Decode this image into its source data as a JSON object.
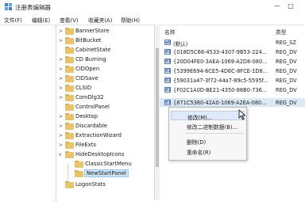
{
  "window": {
    "title": "注册表编辑器",
    "minimize_glyph": "—",
    "maximize_glyph": "□"
  },
  "menubar": [
    "文件(F)",
    "编辑(E)",
    "查看(V)",
    "收藏夹(A)",
    "帮助(H)"
  ],
  "tree": [
    {
      "label": "BannerStore",
      "expander": ">"
    },
    {
      "label": "BitBucket",
      "expander": ">"
    },
    {
      "label": "CabinetState",
      "expander": ""
    },
    {
      "label": "CD Burning",
      "expander": ">"
    },
    {
      "label": "CIDOpen",
      "expander": ">"
    },
    {
      "label": "CIDSave",
      "expander": ">"
    },
    {
      "label": "CLSID",
      "expander": ">"
    },
    {
      "label": "ComDlg32",
      "expander": ">"
    },
    {
      "label": "ControlPanel",
      "expander": ""
    },
    {
      "label": "Desktop",
      "expander": ">"
    },
    {
      "label": "Discardable",
      "expander": ">"
    },
    {
      "label": "ExtractionWizard",
      "expander": ">"
    },
    {
      "label": "FileExts",
      "expander": ">"
    },
    {
      "label": "HideDesktopIcons",
      "expander": "v"
    },
    {
      "label": "ClassicStartMenu",
      "expander": "",
      "child": true
    },
    {
      "label": "NewStartPanel",
      "expander": "",
      "child": true,
      "selected": true
    },
    {
      "label": "LogonStats",
      "expander": ""
    }
  ],
  "list": {
    "col_name": "名称",
    "col_type": "类型",
    "rows": [
      {
        "name": "(默认)",
        "type": "REG_SZ"
      },
      {
        "name": "{018D5C66-4533-4307-9B53-224...",
        "type": "REG_DV"
      },
      {
        "name": "{20D04FE0-3AEA-1069-A2D8-080...",
        "type": "REG_DV"
      },
      {
        "name": "{5399E694-6CE5-4D6C-8FCE-1D8...",
        "type": "REG_DV"
      },
      {
        "name": "{59031a47-3f72-44a7-89c5-5595f...",
        "type": "REG_DV"
      },
      {
        "name": "{F02C1A0D-BE21-4350-88B0-736...",
        "type": "REG_DV"
      },
      {
        "name": "{871C5380-42A0-1069-A2EA-080...",
        "type": "REG_DV"
      }
    ]
  },
  "context_menu": {
    "items": [
      "修改(M)...",
      "修改二进制数据(B)...",
      "删除(D)",
      "重命名(R)"
    ]
  },
  "colors": {
    "folder": "#e9c46a",
    "selection": "#cce4f7",
    "menu_hover": "#e0eaf7"
  }
}
